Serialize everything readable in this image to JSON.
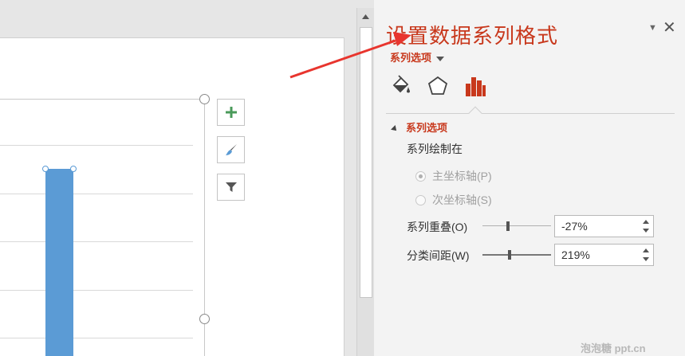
{
  "pane": {
    "title": "设置数据系列格式",
    "dropdown_label": "系列选项",
    "section_header": "系列选项",
    "plot_on_label": "系列绘制在",
    "primary_axis_label": "主坐标轴(P)",
    "secondary_axis_label": "次坐标轴(S)",
    "primary_axis_selected": true,
    "overlap": {
      "label": "系列重叠(O)",
      "value": "-27%",
      "slider_fraction": 0.37
    },
    "gap": {
      "label": "分类间距(W)",
      "value": "219%",
      "slider_fraction": 0.4
    },
    "tabs": [
      {
        "name": "fill-line-icon",
        "active": false
      },
      {
        "name": "effects-icon",
        "active": false
      },
      {
        "name": "series-options-icon",
        "active": true
      }
    ]
  },
  "chart_buttons": [
    "chart-elements-icon",
    "chart-styles-icon",
    "chart-filters-icon"
  ],
  "watermark": "泡泡糖  ppt.cn",
  "colors": {
    "accent": "#c8381c",
    "bar": "#5b9bd5",
    "arrow": "#e8352e",
    "plus": "#4a9a5a"
  }
}
